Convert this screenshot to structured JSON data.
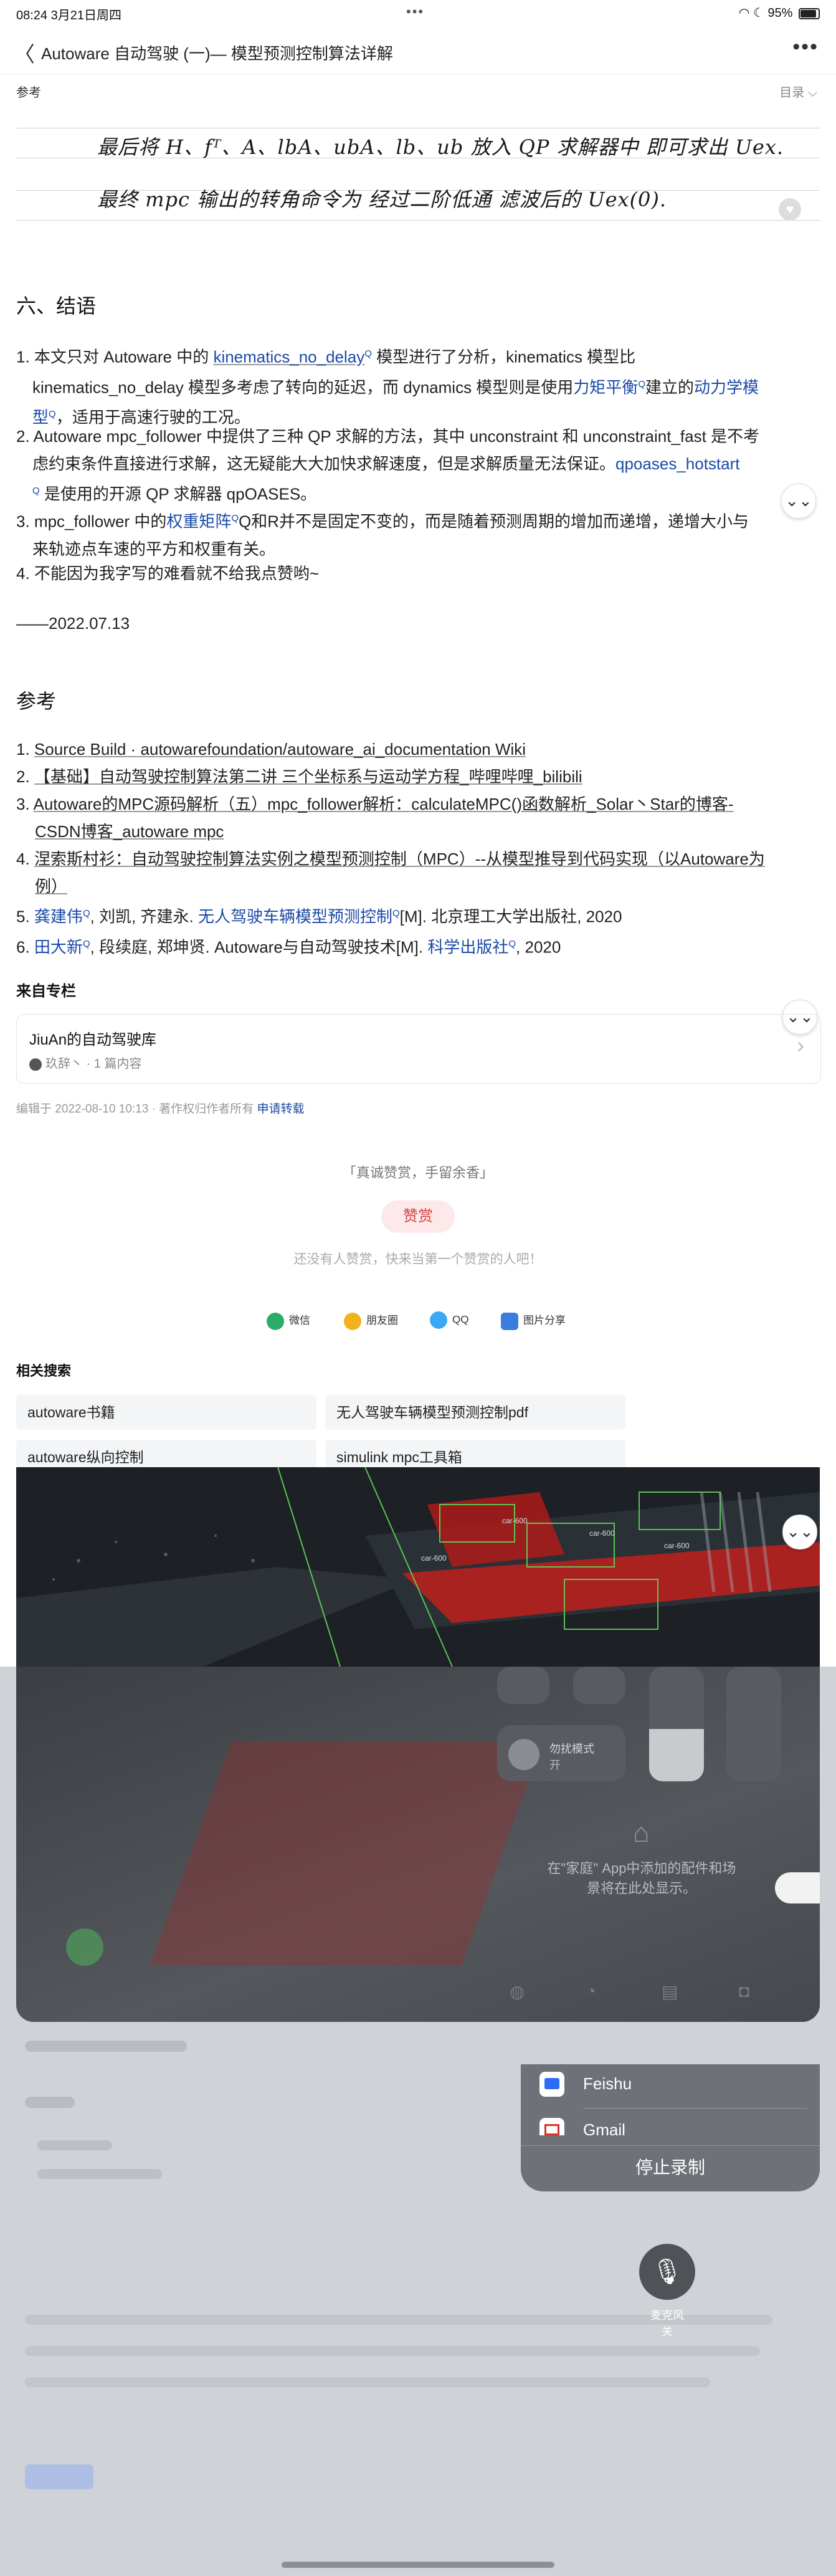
{
  "status_bar": {
    "time_date": "08:24   3月21日周四",
    "dots": "•••",
    "right": "95%"
  },
  "nav": {
    "back_glyph": "〈",
    "title": "Autoware 自动驾驶 (一)— 模型预测控制算法详解",
    "more_glyph": "•••"
  },
  "ref_label_top": "参考",
  "toc_label": "目录 ⌵",
  "handwriting": {
    "line1": "最后将 H、fᵀ、A、lbA、ubA、lb、ub 放入 QP 求解器中 即可求出 Uex.",
    "line2": "最终 mpc 输出的转角命令为 经过二阶低通 滤波后的 Uex(0)."
  },
  "conclusion": {
    "heading": "六、结语",
    "items": [
      {
        "n": "1.",
        "a": "本文只对 Autoware 中的 ",
        "link1": "kinematics_no_delay",
        "b": " 模型进行了分析，kinematics 模型比",
        "c": "kinematics_no_delay 模型多考虑了转向的延迟，而 dynamics 模型则是使用",
        "link2": "力矩平衡",
        "d": "建立的",
        "link3": "动力学模",
        "e": "型",
        "f": "，适用于高速行驶的工况。"
      },
      {
        "n": "2.",
        "a": "Autoware mpc_follower 中提供了三种 QP 求解的方法，其中 unconstraint 和 unconstraint_fast 是不考",
        "b": "虑约束条件直接进行求解，这无疑能大大加快求解速度，但是求解质量无法保证。",
        "link1": "qpoases_hotstart",
        "c": " 是使用的开源 QP 求解器 qpOASES。"
      },
      {
        "n": "3.",
        "a": "mpc_follower 中的",
        "link1": "权重矩阵",
        "b": "Q和R并不是固定不变的，而是随着预测周期的增加而递增，递增大小与",
        "c": "来轨迹点车速的平方和权重有关。"
      },
      {
        "n": "4.",
        "a": "不能因为我字写的难看就不给我点赞哟~"
      }
    ],
    "date": "——2022.07.13"
  },
  "references": {
    "heading": "参考",
    "items": [
      {
        "n": "1.",
        "text": "Source Build · autowarefoundation/autoware_ai_documentation Wiki"
      },
      {
        "n": "2.",
        "text": "【基础】自动驾驶控制算法第二讲 三个坐标系与运动学方程_哔哩哔哩_bilibili"
      },
      {
        "n": "3.",
        "text": "Autoware的MPC源码解析（五）mpc_follower解析：calculateMPC()函数解析_Solar丶Star的博客-",
        "text2": "CSDN博客_autoware mpc"
      },
      {
        "n": "4.",
        "text": "涅索斯村衫：自动驾驶控制算法实例之模型预测控制（MPC）--从模型推导到代码实现（以Autoware为",
        "text2": "例）"
      },
      {
        "n": "5.",
        "link1": "龚建伟",
        "a": ", 刘凯, 齐建永. ",
        "link2": "无人驾驶车辆模型预测控制",
        "b": "[M]. 北京理工大学出版社, 2020"
      },
      {
        "n": "6.",
        "link1": "田大新",
        "a": ", 段续庭, 郑坤贤. Autoware与自动驾驶技术[M]. ",
        "link2": "科学出版社",
        "b": ", 2020"
      }
    ]
  },
  "column": {
    "label": "来自专栏",
    "title": "JiuAn的自动驾驶库",
    "meta": "玖辞丶 · 1 篇内容",
    "chevron": "›"
  },
  "edit_info": {
    "text": "编辑于 2022-08-10 10:13 · 著作权归作者所有 ",
    "link": "申请转载"
  },
  "reward": {
    "quote": "「真诚赞赏，手留余香」",
    "button": "赞赏",
    "empty": "还没有人赞赏，快来当第一个赞赏的人吧！"
  },
  "share": [
    {
      "label": "微信",
      "color": "#2aae67"
    },
    {
      "label": "朋友圈",
      "color": "#f2b21c"
    },
    {
      "label": "QQ",
      "color": "#39a9f4"
    },
    {
      "label": "图片分享",
      "color": "#3b7ddd"
    }
  ],
  "related": {
    "label": "相关搜索",
    "chips": [
      "autoware书籍",
      "无人驾驶车辆模型预测控制pdf",
      "autoware纵向控制",
      "simulink mpc工具箱"
    ]
  },
  "scene_labels": [
    "car-600",
    "car-600",
    "car-600",
    "car-600"
  ],
  "overlay": {
    "home_msg": "在\"家庭\" App中添加的配件和场景将在此处显示。",
    "focus_label": "勿扰模式",
    "focus_sub": "开",
    "sheet_items": [
      "Feishu",
      "Gmail"
    ],
    "stop_recording": "停止录制",
    "mic_label": "麦克风\n关"
  },
  "fold_glyph": "⌄⌄"
}
